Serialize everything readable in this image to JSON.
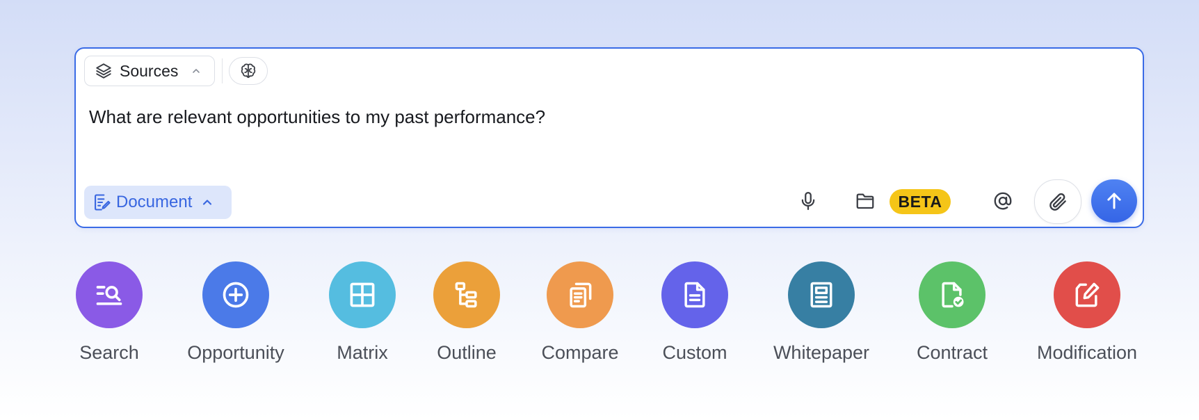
{
  "composer": {
    "sources_label": "Sources",
    "prompt_text": "What are relevant opportunities to my past performance?",
    "mode_label": "Document",
    "beta_label": "BETA",
    "icons": {
      "sources": "layers-icon",
      "sources_chevron": "chevron-up-icon",
      "brain": "brain-icon",
      "mode": "document-edit-icon",
      "mode_chevron": "chevron-up-icon",
      "mic": "microphone-icon",
      "folder": "folder-icon",
      "at": "at-sign-icon",
      "attach": "paperclip-icon",
      "send": "arrow-up-icon"
    },
    "colors": {
      "border": "#3a6be6",
      "mode_bg": "#dde6fb",
      "mode_text": "#3866e0",
      "beta_bg": "#f5c518",
      "send_bg": "#3d6ee8"
    }
  },
  "actions": [
    {
      "label": "Search",
      "icon": "search-list-icon",
      "color": "#8a5ae6"
    },
    {
      "label": "Opportunity",
      "icon": "plus-circle-icon",
      "color": "#4b7ae8"
    },
    {
      "label": "Matrix",
      "icon": "grid-icon",
      "color": "#55bde0"
    },
    {
      "label": "Outline",
      "icon": "tree-outline-icon",
      "color": "#eba03a"
    },
    {
      "label": "Compare",
      "icon": "copy-documents-icon",
      "color": "#ef9a4e"
    },
    {
      "label": "Custom",
      "icon": "document-icon",
      "color": "#6463ea"
    },
    {
      "label": "Whitepaper",
      "icon": "newspaper-icon",
      "color": "#377fa3"
    },
    {
      "label": "Contract",
      "icon": "document-check-icon",
      "color": "#5cc269"
    },
    {
      "label": "Modification",
      "icon": "edit-document-icon",
      "color": "#e14e4a"
    }
  ]
}
